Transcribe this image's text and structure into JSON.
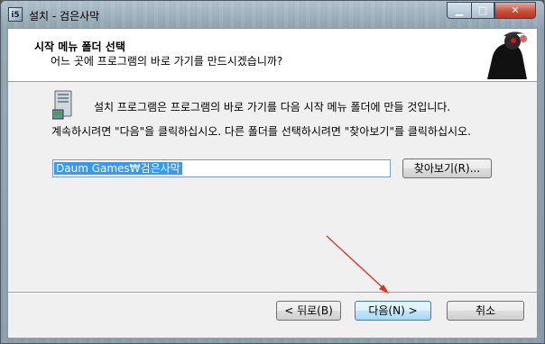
{
  "window": {
    "title": "설치 - 검은사막",
    "app_icon_text": "i5"
  },
  "header": {
    "title": "시작 메뉴 폴더 선택",
    "subtitle": "어느 곳에 프로그램의 바로 가기를 만드시겠습니까?"
  },
  "main": {
    "message1": "설치 프로그램은 프로그램의 바로 가기를 다음 시작 메뉴 폴더에 만들 것입니다.",
    "message2": "계속하시려면 \"다음\"을 클릭하십시오. 다른 폴더를 선택하시려면 \"찾아보기\"를 클릭하십시오.",
    "folder_value": "Daum Games₩검은사막",
    "browse_label": "찾아보기(R)..."
  },
  "footer": {
    "back_label": "< 뒤로(B)",
    "next_label": "다음(N) >",
    "cancel_label": "취소"
  },
  "colors": {
    "accent": "#3399ff",
    "annotation_arrow": "#e03020",
    "close_button": "#c74a34"
  },
  "icons": [
    "app-icon",
    "minimize-icon",
    "maximize-icon",
    "close-icon",
    "logo-icon",
    "computer-icon",
    "arrow-annotation"
  ]
}
